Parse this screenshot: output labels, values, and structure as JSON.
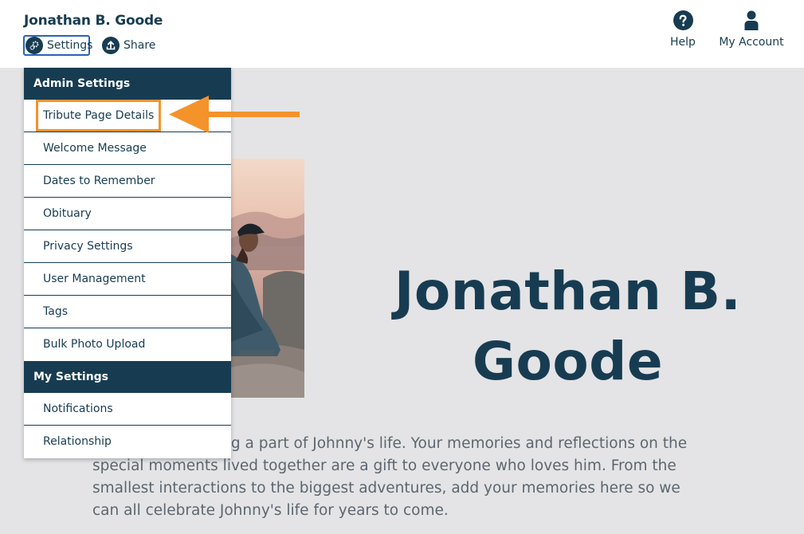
{
  "header": {
    "page_name": "Jonathan B. Goode",
    "settings_label": "Settings",
    "share_label": "Share",
    "help_label": "Help",
    "account_label": "My Account"
  },
  "hero": {
    "title": "Jonathan B. Goode",
    "intro_text": "Thank you for being a part of Johnny's life. Your memories and reflections on the special moments lived together are a gift to everyone who loves him. From the smallest interactions to the biggest adventures, add your memories here so we can all celebrate Johnny's life for years to come."
  },
  "menu": {
    "admin_header": "Admin Settings",
    "admin_items": [
      {
        "label": "Tribute Page Details"
      },
      {
        "label": "Welcome Message"
      },
      {
        "label": "Dates to Remember"
      },
      {
        "label": "Obituary"
      },
      {
        "label": "Privacy Settings"
      },
      {
        "label": "User Management"
      },
      {
        "label": "Tags"
      },
      {
        "label": "Bulk Photo Upload"
      }
    ],
    "my_header": "My Settings",
    "my_items": [
      {
        "label": "Notifications"
      },
      {
        "label": "Relationship"
      }
    ]
  },
  "colors": {
    "primary": "#173c52",
    "highlight": "#f5932b",
    "focus_outline": "#2b62b8",
    "background": "#e4e4e6"
  },
  "icons": {
    "settings": "gear-icon",
    "share": "upload-icon",
    "help": "question-icon",
    "account": "user-icon",
    "annotation": "arrow-left-icon"
  }
}
